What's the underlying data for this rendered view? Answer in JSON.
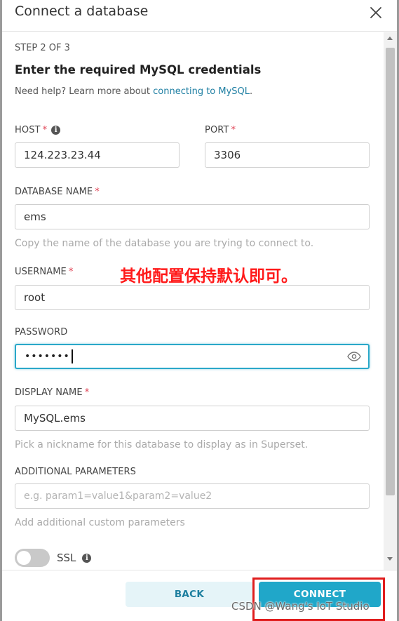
{
  "modal": {
    "title": "Connect a database",
    "close_icon": "close-icon"
  },
  "step": "STEP 2 OF 3",
  "heading": "Enter the required MySQL credentials",
  "help": {
    "prefix": "Need help? Learn more about ",
    "link": "connecting to MySQL",
    "suffix": "."
  },
  "fields": {
    "host": {
      "label": "HOST",
      "required": "*",
      "value": "124.223.23.44",
      "info_icon": "info-icon"
    },
    "port": {
      "label": "PORT",
      "required": "*",
      "value": "3306"
    },
    "database_name": {
      "label": "DATABASE NAME",
      "required": "*",
      "value": "ems",
      "hint": "Copy the name of the database you are trying to connect to."
    },
    "username": {
      "label": "USERNAME",
      "required": "*",
      "value": "root"
    },
    "password": {
      "label": "PASSWORD",
      "value": "•••••••",
      "eye_icon": "eye-icon"
    },
    "display_name": {
      "label": "DISPLAY NAME",
      "required": "*",
      "value": "MySQL.ems",
      "hint": "Pick a nickname for this database to display as in Superset."
    },
    "additional_parameters": {
      "label": "ADDITIONAL PARAMETERS",
      "placeholder": "e.g. param1=value1&param2=value2",
      "hint": "Add additional custom parameters"
    }
  },
  "ssl": {
    "label": "SSL",
    "enabled": false,
    "info_icon": "info-icon"
  },
  "annotation": "其他配置保持默认即可。",
  "footer": {
    "back_label": "BACK",
    "connect_label": "CONNECT"
  },
  "watermark": "CSDN @Wang's IoT Studio",
  "colors": {
    "accent": "#20a7c9",
    "link": "#1f7fa3",
    "required": "#e04355",
    "annotation": "#ff1a1a"
  }
}
